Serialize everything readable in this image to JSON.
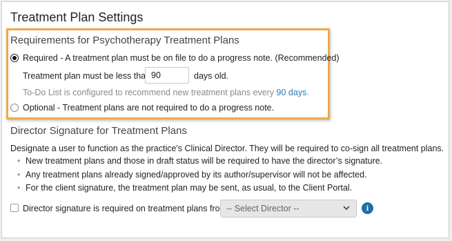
{
  "page": {
    "title": "Treatment Plan Settings"
  },
  "requirements": {
    "heading": "Requirements for Psychotherapy Treatment Plans",
    "required_option": {
      "label": "Required - A treatment plan must be on file to do a progress note. (Recommended)",
      "selected": true
    },
    "age_prefix": "Treatment plan must be less than",
    "age_value": "90",
    "age_suffix": "days old.",
    "todo_text": "To-Do List is configured to recommend new treatment plans every",
    "todo_link": "90 days",
    "todo_period": ".",
    "optional_option": {
      "label": "Optional - Treatment plans are not required to do a progress note.",
      "selected": false
    },
    "highlight_color": "#f0a848"
  },
  "director": {
    "heading": "Director Signature for Treatment Plans",
    "description": "Designate a user to function as the practice's Clinical Director. They will be required to co-sign all treatment plans.",
    "bullets": [
      "New treatment plans and those in draft status will be required to have the director’s signature.",
      "Any treatment plans already signed/approved by its author/supervisor will not be affected.",
      "For the client signature, the treatment plan may be sent, as usual, to the Client Portal."
    ],
    "checkbox_label": "Director signature is required on treatment plans from:",
    "checkbox_checked": false,
    "select_placeholder": "-- Select Director --",
    "info_glyph": "i",
    "info_color": "#1f6fa8"
  }
}
